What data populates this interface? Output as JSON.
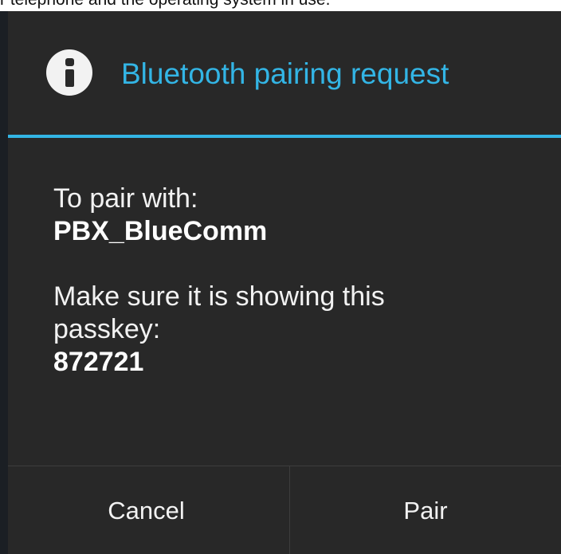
{
  "caption": "r telephone and the operating system in use.",
  "dialog": {
    "icon": "info-icon",
    "title": "Bluetooth pairing request",
    "accent_color": "#33b5e5",
    "background_color": "#282828",
    "pair_with_label": "To pair with:",
    "device_name": "PBX_BlueComm",
    "instruction_line1": "Make sure it is showing this",
    "instruction_line2": "passkey:",
    "passkey": "872721"
  },
  "buttons": {
    "cancel_label": "Cancel",
    "pair_label": "Pair"
  }
}
